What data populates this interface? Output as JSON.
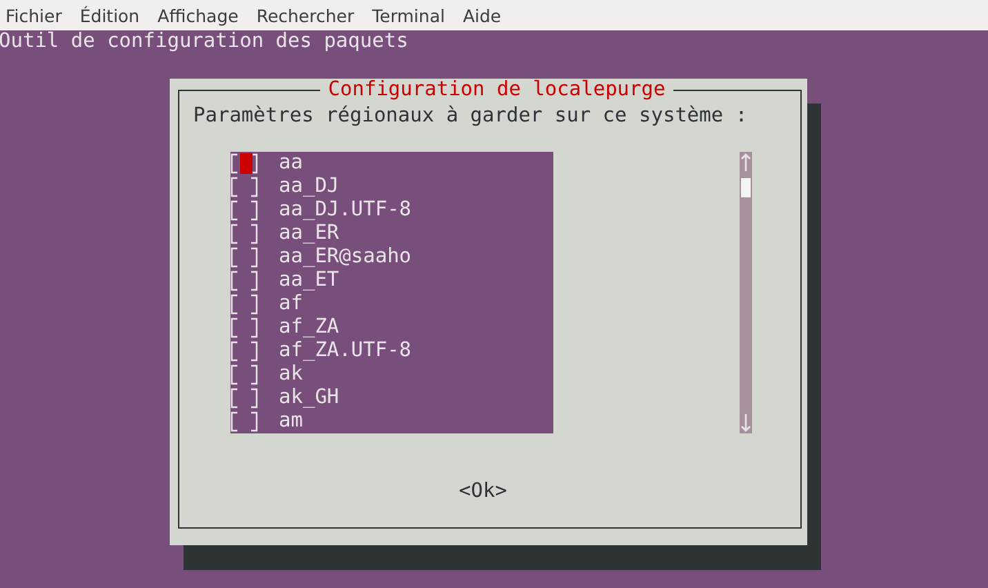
{
  "menu": [
    "Fichier",
    "Édition",
    "Affichage",
    "Rechercher",
    "Terminal",
    "Aide"
  ],
  "terminal": {
    "header": "Outil de configuration des paquets"
  },
  "dialog": {
    "title": "Configuration de localepurge",
    "prompt": "Paramètres régionaux à garder sur ce système :",
    "items": [
      {
        "label": "aa",
        "checked": false,
        "focused": true
      },
      {
        "label": "aa_DJ",
        "checked": false,
        "focused": false
      },
      {
        "label": "aa_DJ.UTF-8",
        "checked": false,
        "focused": false
      },
      {
        "label": "aa_ER",
        "checked": false,
        "focused": false
      },
      {
        "label": "aa_ER@saaho",
        "checked": false,
        "focused": false
      },
      {
        "label": "aa_ET",
        "checked": false,
        "focused": false
      },
      {
        "label": "af",
        "checked": false,
        "focused": false
      },
      {
        "label": "af_ZA",
        "checked": false,
        "focused": false
      },
      {
        "label": "af_ZA.UTF-8",
        "checked": false,
        "focused": false
      },
      {
        "label": "ak",
        "checked": false,
        "focused": false
      },
      {
        "label": "ak_GH",
        "checked": false,
        "focused": false
      },
      {
        "label": "am",
        "checked": false,
        "focused": false
      }
    ],
    "button": "<Ok>"
  }
}
